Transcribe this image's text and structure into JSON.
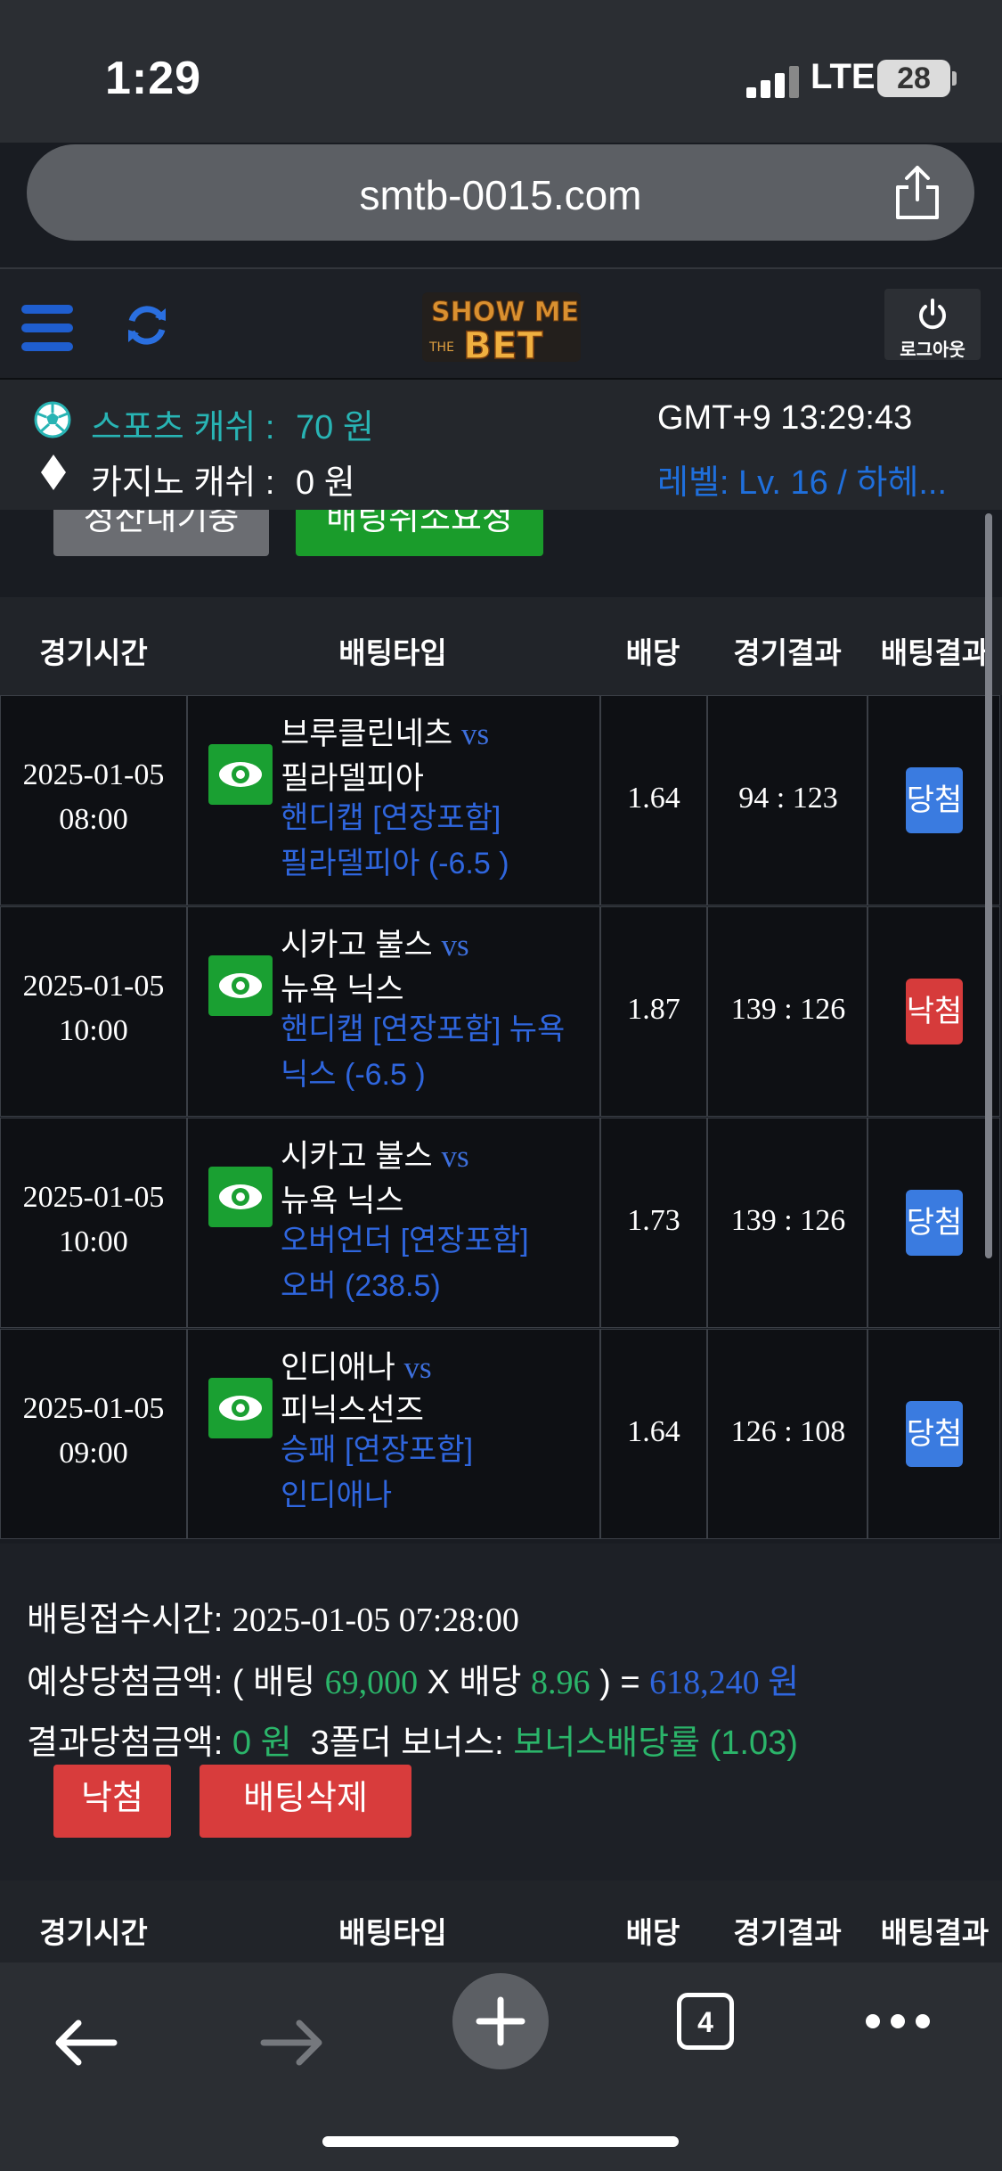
{
  "status_bar": {
    "time": "1:29",
    "network": "LTE",
    "battery": "28"
  },
  "browser": {
    "url": "smtb-0015.com",
    "tab_count": "4"
  },
  "header": {
    "logout_label": "로그아웃"
  },
  "info": {
    "sports_label": "스포츠 캐쉬 :",
    "sports_amount": "70 원",
    "casino_label": "카지노 캐쉬 :",
    "casino_amount": "0 원",
    "clock": "GMT+9 13:29:43",
    "level": "레벨: Lv. 16 / 하헤..."
  },
  "top_buttons": {
    "hide": "정산내기중",
    "cancel_request": "배팅취소요청"
  },
  "table_headers": [
    "경기시간",
    "배팅타입",
    "배당",
    "경기결과",
    "배팅결과"
  ],
  "rows": [
    {
      "date": "2025-01-05",
      "time": "08:00",
      "home": "브루클린네츠",
      "vs": "vs",
      "away": "필라델피아",
      "bet_type": "핸디캡 [연장포함] 필라델피아 (-6.5 )",
      "odds": "1.64",
      "score": "94 : 123",
      "result": "당첨"
    },
    {
      "date": "2025-01-05",
      "time": "10:00",
      "home": "시카고 불스",
      "vs": "vs",
      "away": "뉴욕 닉스",
      "bet_type": "핸디캡 [연장포함] 뉴욕 닉스 (-6.5 )",
      "odds": "1.87",
      "score": "139 : 126",
      "result": "낙첨"
    },
    {
      "date": "2025-01-05",
      "time": "10:00",
      "home": "시카고 불스",
      "vs": "vs",
      "away": "뉴욕 닉스",
      "bet_type": "오버언더 [연장포함] 오버 (238.5)",
      "odds": "1.73",
      "score": "139 : 126",
      "result": "당첨"
    },
    {
      "date": "2025-01-05",
      "time": "09:00",
      "home": "인디애나",
      "vs": "vs",
      "away": "피닉스선즈",
      "bet_type": "승패 [연장포함] 인디애나",
      "odds": "1.64",
      "score": "126 : 108",
      "result": "당첨"
    }
  ],
  "summary": {
    "accept_label": "배팅접수시간:",
    "accept_time": "2025-01-05 07:28:00",
    "expected_label": "예상당첨금액:",
    "expected_open": "( 배팅",
    "bet_amount": "69,000",
    "times": "X 배당",
    "total_odds": "8.96",
    "expected_close": ") =",
    "expected_win": "618,240 원",
    "result_label": "결과당첨금액:",
    "result_amount": "0 원",
    "bonus_label": "3폴더 보너스:",
    "bonus_value": "보너스배당률 (1.03)",
    "lose_button": "낙첨",
    "delete_button": "배팅삭제"
  },
  "colors": {
    "win": "#3a7be0",
    "lose": "#d63b3b",
    "eye": "#1aa032",
    "accent": "#28b4b4"
  }
}
